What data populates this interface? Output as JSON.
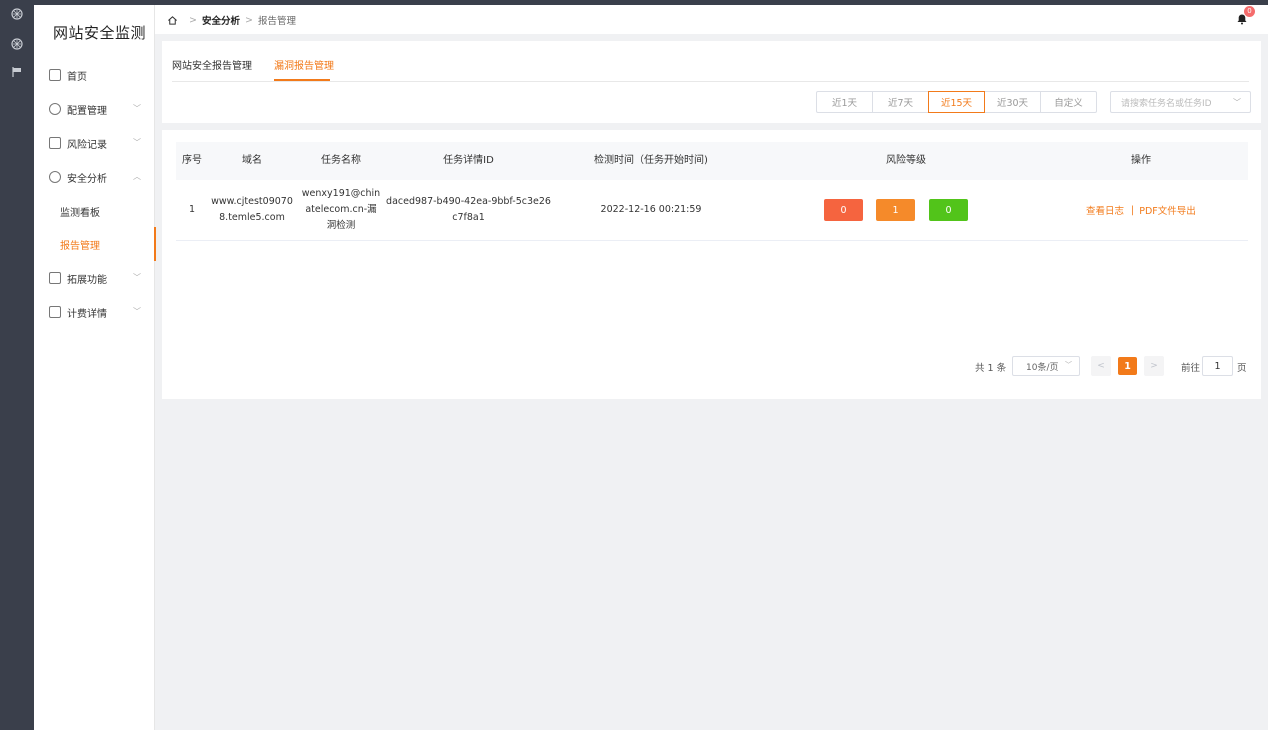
{
  "app": {
    "title": "网站安全监测"
  },
  "rail": {
    "icons": [
      "dashboard-icon",
      "dashboard-icon",
      "flag-icon"
    ]
  },
  "sidebar": {
    "items": [
      {
        "label": "首页",
        "icon": "monitor-icon"
      },
      {
        "label": "配置管理",
        "icon": "globe-icon"
      },
      {
        "label": "风险记录",
        "icon": "screen-icon"
      },
      {
        "label": "安全分析",
        "icon": "shield-icon"
      },
      {
        "label": "监测看板"
      },
      {
        "label": "报告管理"
      },
      {
        "label": "拓展功能",
        "icon": "search-doc-icon"
      },
      {
        "label": "计费详情",
        "icon": "billing-icon"
      }
    ]
  },
  "header": {
    "breadcrumb": {
      "parent": "安全分析",
      "current": "报告管理"
    },
    "notification_count": "0"
  },
  "tabs": [
    "网站安全报告管理",
    "漏洞报告管理"
  ],
  "filters": {
    "ranges": [
      "近1天",
      "近7天",
      "近15天",
      "近30天",
      "自定义"
    ],
    "active_range": "近15天",
    "search_placeholder": "请搜索任务名或任务ID"
  },
  "table": {
    "columns": [
      "序号",
      "域名",
      "任务名称",
      "任务详情ID",
      "检测时间（任务开始时间)",
      "风险等级",
      "操作"
    ],
    "rows": [
      {
        "index": "1",
        "domain_l1": "www.cjtest09070",
        "domain_l2": "8.temle5.com",
        "task_l1": "wenxy191@chin",
        "task_l2": "atelecom.cn-漏",
        "task_l3": "洞检测",
        "id_l1": "daced987-b490-42ea-9bbf-5c3e26",
        "id_l2": "c7f8a1",
        "time": "2022-12-16 00:21:59",
        "risk_high": "0",
        "risk_medium": "1",
        "risk_low": "0",
        "op_log": "查看日志",
        "op_pdf": "PDF文件导出"
      }
    ]
  },
  "pagination": {
    "total": "共 1 条",
    "page_size": "10条/页",
    "current_page": "1",
    "goto_label": "前往",
    "goto_value": "1",
    "page_unit": "页"
  },
  "colors": {
    "accent": "#f27a1a",
    "risk_high": "#f5643f",
    "risk_medium": "#f58a2a",
    "risk_low": "#52c41a"
  }
}
